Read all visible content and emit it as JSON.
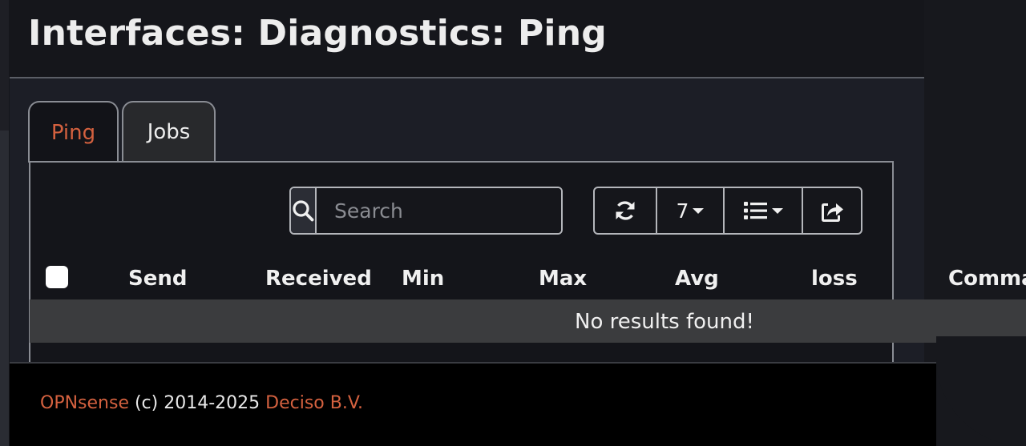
{
  "page": {
    "title": "Interfaces: Diagnostics: Ping"
  },
  "tabs": [
    {
      "label": "Ping",
      "active": true
    },
    {
      "label": "Jobs",
      "active": false
    }
  ],
  "toolbar": {
    "search_placeholder": "Search",
    "search_icon": "search-icon",
    "refresh_icon": "refresh-icon",
    "page_size": "7",
    "columns_icon": "list-icon",
    "export_icon": "share-icon"
  },
  "table": {
    "columns": [
      "Send",
      "Received",
      "Min",
      "Max",
      "Avg",
      "loss",
      "Comman"
    ],
    "empty_message": "No results found!"
  },
  "footer": {
    "brand": "OPNsense",
    "copyright": " (c) 2014-2025 ",
    "company": "Deciso B.V."
  },
  "colors": {
    "accent": "#d4613f",
    "background": "#15161b",
    "footer": "#000000"
  }
}
